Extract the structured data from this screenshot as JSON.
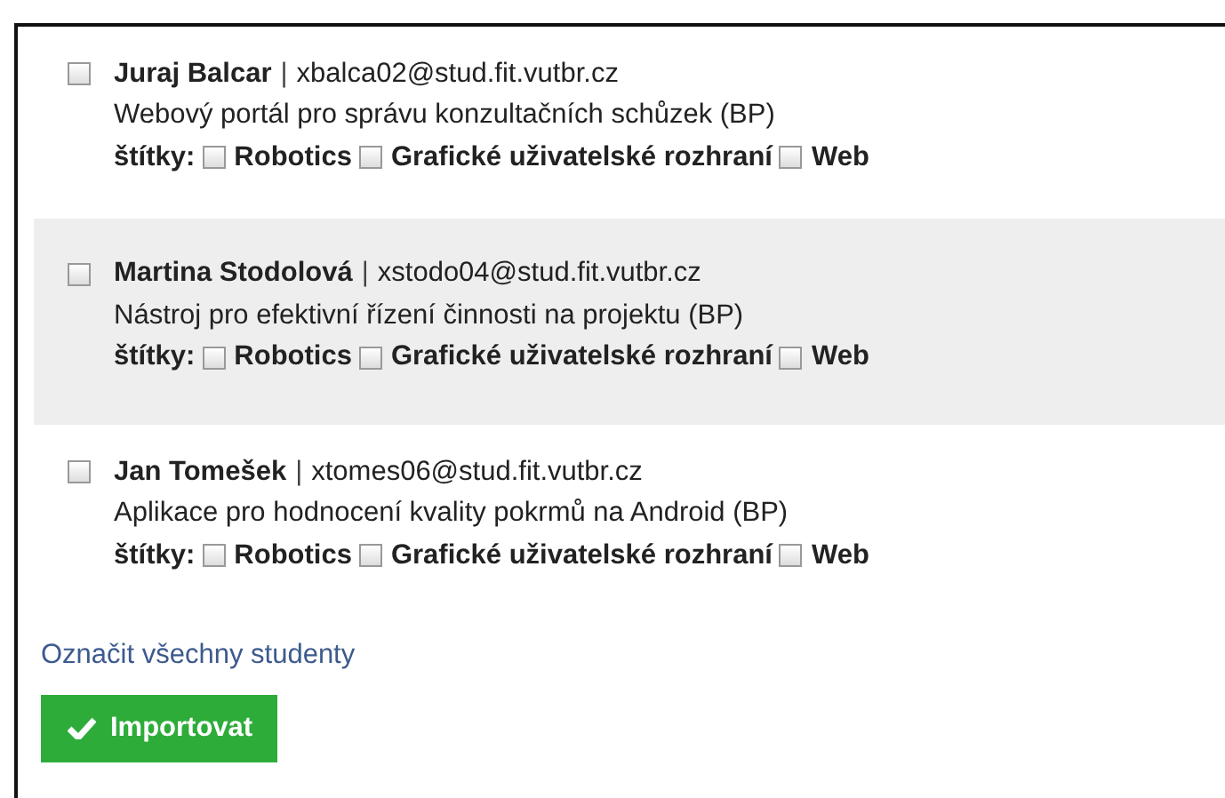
{
  "students": [
    {
      "checked": false,
      "highlighted": false,
      "name": "Juraj Balcar",
      "separator": "|",
      "email": "xbalca02@stud.fit.vutbr.cz",
      "thesis": "Webový portál pro správu konzultačních schůzek (BP)",
      "tags_label": "štítky:",
      "tags": [
        {
          "label": "Robotics",
          "checked": false
        },
        {
          "label": "Grafické uživatelské rozhraní",
          "checked": false
        },
        {
          "label": "Web",
          "checked": false
        }
      ]
    },
    {
      "checked": false,
      "highlighted": true,
      "name": "Martina Stodolová",
      "separator": "|",
      "email": "xstodo04@stud.fit.vutbr.cz",
      "thesis": "Nástroj pro efektivní řízení činnosti na projektu (BP)",
      "tags_label": "štítky:",
      "tags": [
        {
          "label": "Robotics",
          "checked": false
        },
        {
          "label": "Grafické uživatelské rozhraní",
          "checked": false
        },
        {
          "label": "Web",
          "checked": false
        }
      ]
    },
    {
      "checked": false,
      "highlighted": false,
      "name": "Jan Tomešek",
      "separator": "|",
      "email": "xtomes06@stud.fit.vutbr.cz",
      "thesis": "Aplikace pro hodnocení kvality pokrmů na Android (BP)",
      "tags_label": "štítky:",
      "tags": [
        {
          "label": "Robotics",
          "checked": false
        },
        {
          "label": "Grafické uživatelské rozhraní",
          "checked": false
        },
        {
          "label": "Web",
          "checked": false
        }
      ]
    }
  ],
  "select_all_link": "Označit všechny studenty",
  "import_button": "Importovat"
}
